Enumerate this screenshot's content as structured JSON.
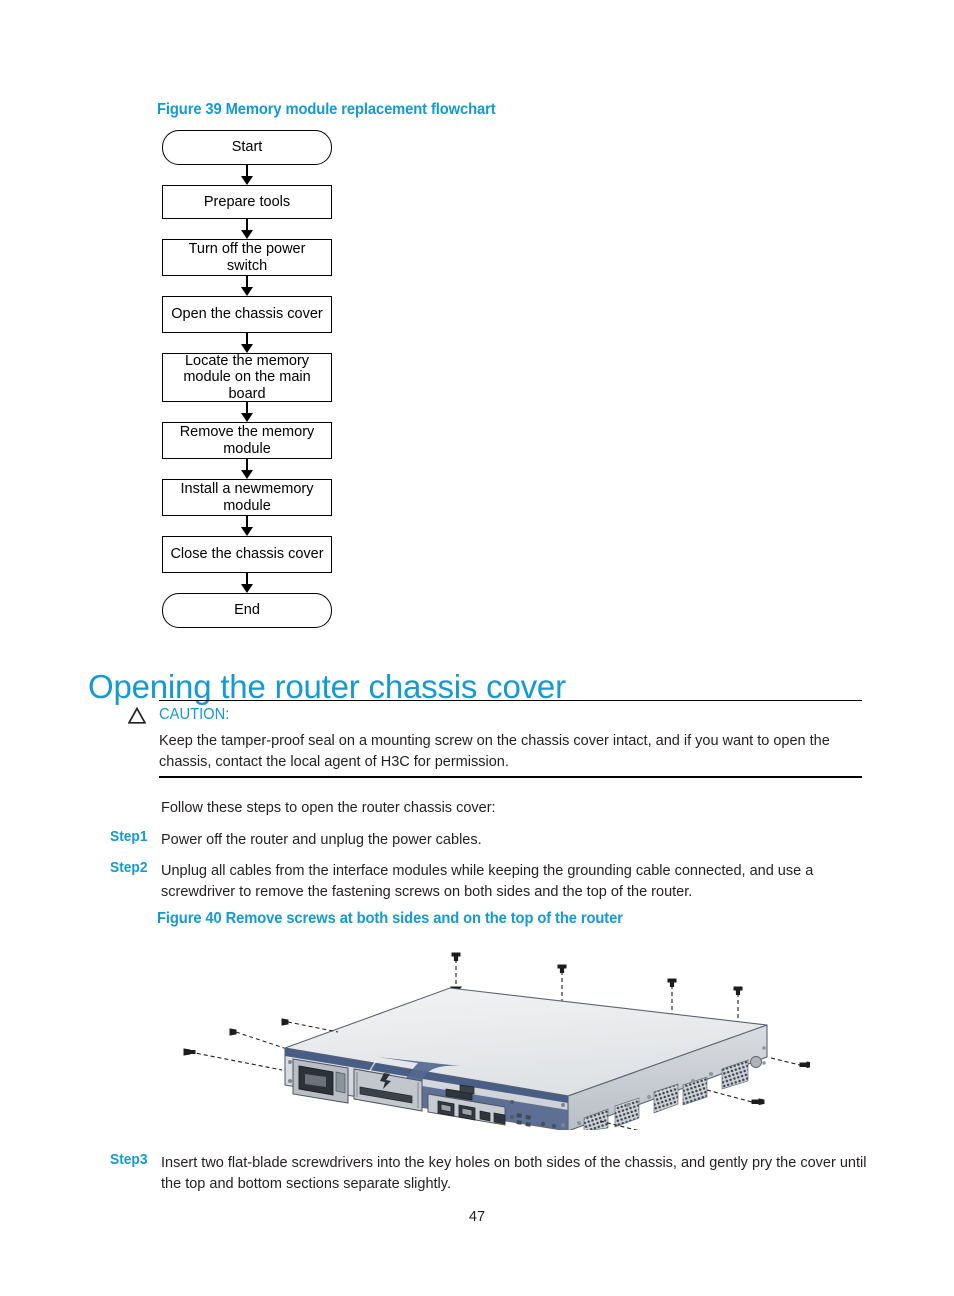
{
  "page": {
    "number": "47"
  },
  "figure39": {
    "caption": "Figure 39 Memory module replacement flowchart",
    "flowchart": {
      "nodes": [
        {
          "label": "Start",
          "shape": "terminal"
        },
        {
          "label": "Prepare tools",
          "shape": "process"
        },
        {
          "label": "Turn off the power switch",
          "shape": "process"
        },
        {
          "label": "Open the chassis cover",
          "shape": "process"
        },
        {
          "label": "Locate the memory module on the main board",
          "shape": "process"
        },
        {
          "label": "Remove the memory module",
          "shape": "process"
        },
        {
          "label": "Install a newmemory module",
          "shape": "process"
        },
        {
          "label": "Close the chassis cover",
          "shape": "process"
        },
        {
          "label": "End",
          "shape": "terminal"
        }
      ]
    }
  },
  "section": {
    "heading": "Opening the router chassis cover"
  },
  "caution": {
    "icon": "warning-triangle-icon",
    "label": "CAUTION:",
    "body": "Keep the tamper-proof seal on a mounting screw on the chassis cover intact, and if you want to open the chassis, contact the local agent of H3C for permission."
  },
  "procedure": {
    "intro": "Follow these steps to open the router chassis cover:",
    "steps": [
      {
        "label": "Step1",
        "text": "Power off the router and unplug the power cables."
      },
      {
        "label": "Step2",
        "text": "Unplug all cables from the interface modules while keeping the grounding cable connected, and use a screwdriver to remove the fastening screws on both sides and the top of the router."
      },
      {
        "label": "Step3",
        "text": "Insert two flat-blade screwdrivers into the key holes on both sides of the chassis, and gently pry the cover until the top and bottom sections separate slightly."
      }
    ]
  },
  "figure40": {
    "caption": "Figure 40 Remove screws at both sides and on the top of the router",
    "illustration": {
      "alt": "Isometric view of a 1U rack-mount router with fastening screws being removed from the top and both sides, shown with dashed pull-out lines",
      "parts": [
        "chassis-top-cover",
        "front-panel",
        "power-supply-module",
        "blank-filler-panel",
        "interface-module-ports",
        "ventilation-grilles",
        "fastening-screws"
      ]
    }
  },
  "colors": {
    "accent_blue": "#139ad6",
    "text": "#231f20",
    "chassis_top": "#e9ebed",
    "chassis_front_trim": "#4a5d85",
    "chassis_body": "#d5d8dc",
    "outline": "#3a4350"
  }
}
